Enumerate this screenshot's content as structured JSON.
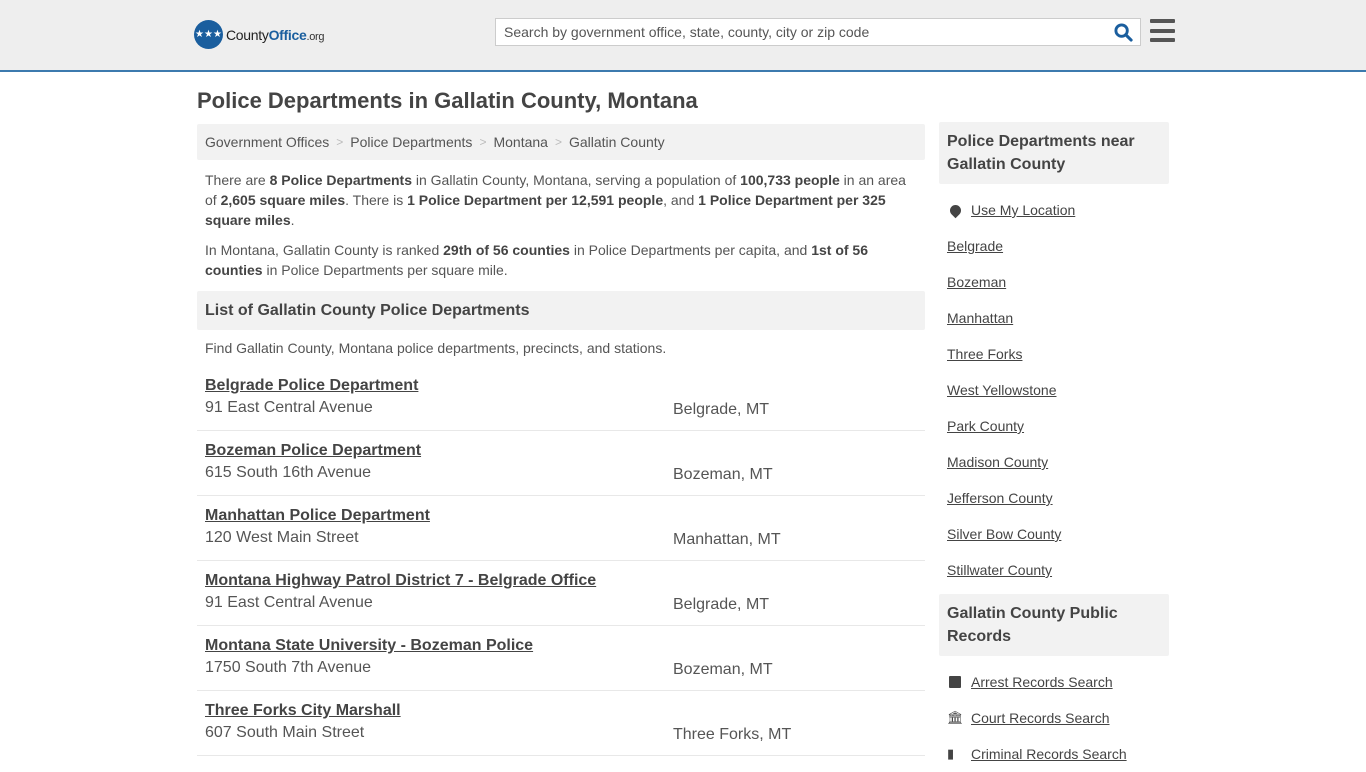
{
  "header": {
    "logo": {
      "prefix": "County",
      "brand": "Office",
      "suffix": ".org"
    },
    "search_placeholder": "Search by government office, state, county, city or zip code",
    "search_icon": "search-icon",
    "menu_icon": "hamburger-menu-icon"
  },
  "page_title": "Police Departments in Gallatin County, Montana",
  "breadcrumb": [
    "Government Offices",
    "Police Departments",
    "Montana",
    "Gallatin County"
  ],
  "intro": {
    "p1": [
      {
        "t": "There are ",
        "b": false
      },
      {
        "t": "8 Police Departments",
        "b": true
      },
      {
        "t": " in Gallatin County, Montana, serving a population of ",
        "b": false
      },
      {
        "t": "100,733 people",
        "b": true
      },
      {
        "t": " in an area of ",
        "b": false
      },
      {
        "t": "2,605 square miles",
        "b": true
      },
      {
        "t": ". There is ",
        "b": false
      },
      {
        "t": "1 Police Department per 12,591 people",
        "b": true
      },
      {
        "t": ", and ",
        "b": false
      },
      {
        "t": "1 Police Department per 325 square miles",
        "b": true
      },
      {
        "t": ".",
        "b": false
      }
    ],
    "p2": [
      {
        "t": "In Montana, Gallatin County is ranked ",
        "b": false
      },
      {
        "t": "29th of 56 counties",
        "b": true
      },
      {
        "t": " in Police Departments per capita, and ",
        "b": false
      },
      {
        "t": "1st of 56 counties",
        "b": true
      },
      {
        "t": " in Police Departments per square mile.",
        "b": false
      }
    ]
  },
  "list_section": {
    "title": "List of Gallatin County Police Departments",
    "description": "Find Gallatin County, Montana police departments, precincts, and stations."
  },
  "listings": [
    {
      "name": "Belgrade Police Department",
      "address": "91 East Central Avenue",
      "city": "Belgrade, MT"
    },
    {
      "name": "Bozeman Police Department",
      "address": "615 South 16th Avenue",
      "city": "Bozeman, MT"
    },
    {
      "name": "Manhattan Police Department",
      "address": "120 West Main Street",
      "city": "Manhattan, MT"
    },
    {
      "name": "Montana Highway Patrol District 7 - Belgrade Office",
      "address": "91 East Central Avenue",
      "city": "Belgrade, MT"
    },
    {
      "name": "Montana State University - Bozeman Police",
      "address": "1750 South 7th Avenue",
      "city": "Bozeman, MT"
    },
    {
      "name": "Three Forks City Marshall",
      "address": "607 South Main Street",
      "city": "Three Forks, MT"
    }
  ],
  "sidebar": {
    "nearby": {
      "title": "Police Departments near Gallatin County",
      "use_location": "Use My Location",
      "links": [
        "Belgrade",
        "Bozeman",
        "Manhattan",
        "Three Forks",
        "West Yellowstone",
        "Park County",
        "Madison County",
        "Jefferson County",
        "Silver Bow County",
        "Stillwater County"
      ]
    },
    "records": {
      "title": "Gallatin County Public Records",
      "links": [
        {
          "label": "Arrest Records Search",
          "icon": "arrest-records-icon"
        },
        {
          "label": "Court Records Search",
          "icon": "courthouse-icon"
        },
        {
          "label": "Criminal Records Search",
          "icon": "criminal-records-icon"
        }
      ]
    }
  },
  "colors": {
    "brand_blue": "#1a5e9e",
    "header_border": "#3c7aae",
    "panel_bg": "#f2f2f2"
  }
}
